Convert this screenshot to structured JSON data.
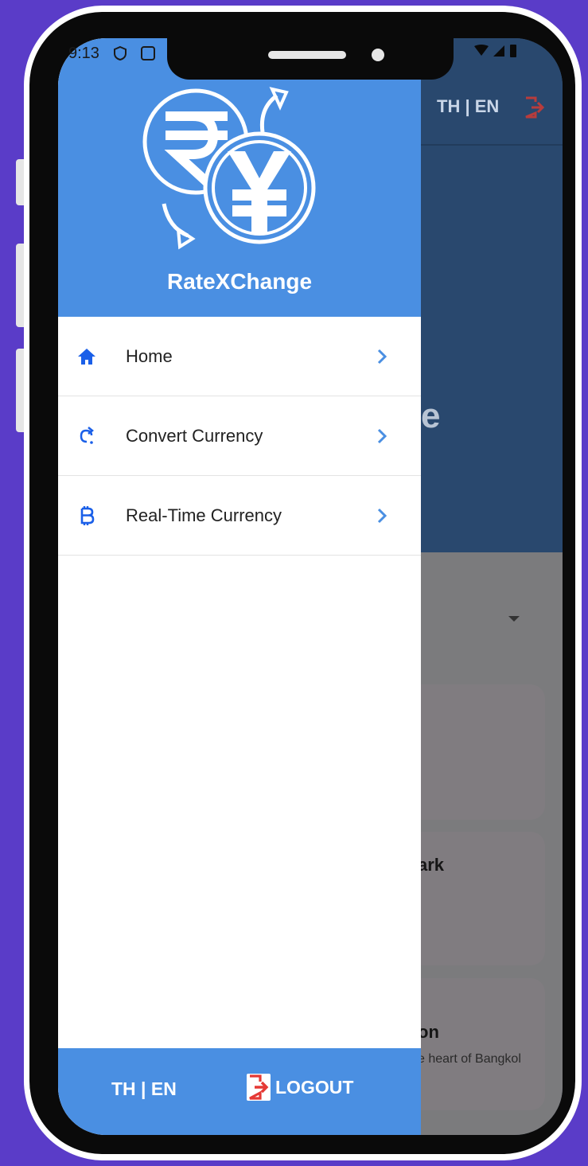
{
  "status_bar": {
    "time": "9:13"
  },
  "background_app": {
    "header_lang": "TH | EN",
    "title_fragment": "e",
    "card_2_title_fragment": "ark",
    "card_3_title_fragment": "on",
    "card_3_subtitle_fragment": "e heart of Bangkol"
  },
  "drawer": {
    "app_name": "RateXChange",
    "menu": [
      {
        "label": "Home",
        "icon": "home-icon"
      },
      {
        "label": "Convert Currency",
        "icon": "convert-arrow-icon"
      },
      {
        "label": "Real-Time Currency",
        "icon": "bitcoin-icon"
      }
    ],
    "footer": {
      "lang": "TH | EN",
      "logout_label": "LOGOUT"
    }
  },
  "colors": {
    "drawer_blue": "#4a8fe2",
    "icon_blue": "#1a5fe8",
    "logout_red": "#e53935",
    "frame_purple": "#5a3cc8"
  }
}
